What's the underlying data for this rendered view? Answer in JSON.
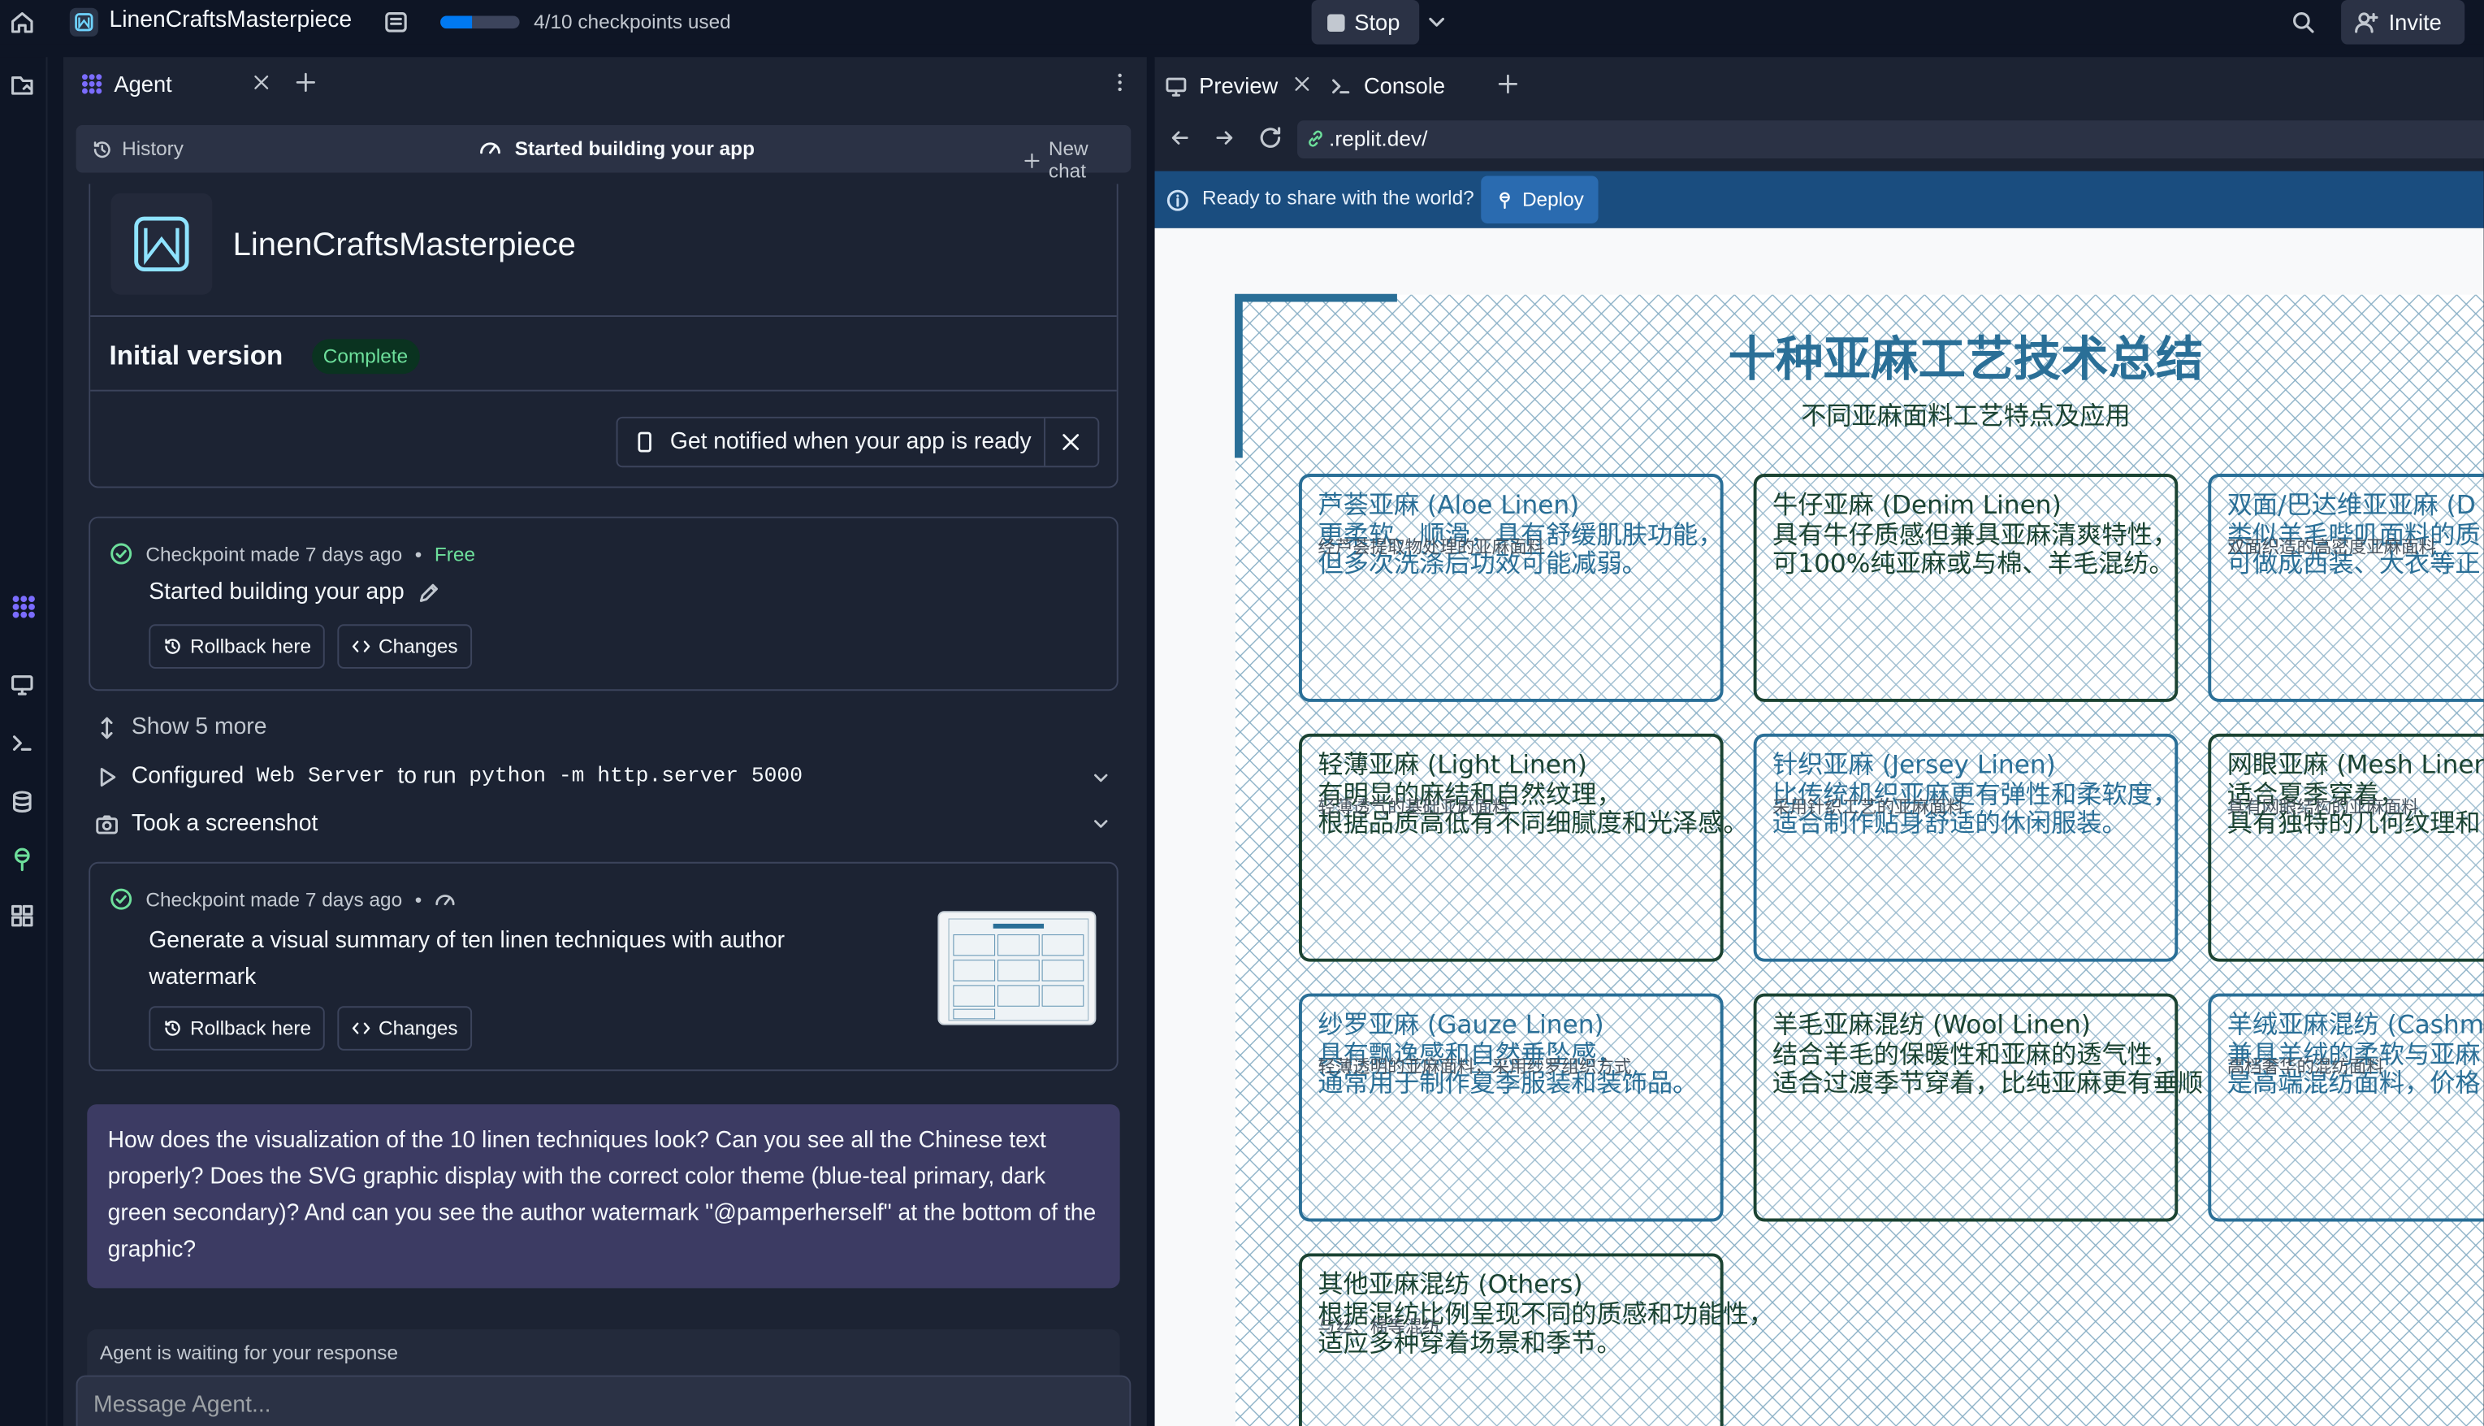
{
  "topbar": {
    "app_name": "LinenCraftsMasterpiece",
    "checkpoints_text": "4/10 checkpoints used",
    "checkpoints_progress": 0.4,
    "stop_label": "Stop",
    "invite_label": "Invite"
  },
  "agent_panel": {
    "tab_label": "Agent",
    "history_label": "History",
    "status_label": "Started building your app",
    "new_chat_label": "New chat",
    "app_title": "LinenCraftsMasterpiece",
    "initial_version_label": "Initial version",
    "complete_badge": "Complete",
    "notify_label": "Get notified when your app is ready",
    "checkpoint1": {
      "meta": "Checkpoint made 7 days ago",
      "separator": "•",
      "price": "Free",
      "title": "Started building your app",
      "rollback_label": "Rollback here",
      "changes_label": "Changes"
    },
    "show_more_label": "Show 5 more",
    "configured": {
      "prefix": "Configured",
      "workflow": "Web Server",
      "middle": "to run",
      "command": "python -m http.server 5000"
    },
    "screenshot_label": "Took a screenshot",
    "checkpoint2": {
      "meta": "Checkpoint made 7 days ago",
      "separator": "•",
      "title": "Generate a visual summary of ten linen techniques with author watermark",
      "rollback_label": "Rollback here",
      "changes_label": "Changes"
    },
    "user_message": "How does the visualization of the 10 linen techniques look? Can you see all the Chinese text properly? Does the SVG graphic display with the correct color theme (blue-teal primary, dark green secondary)? And can you see the author watermark \"@pamperherself\" at the bottom of the graphic?",
    "waiting_label": "Agent is waiting for your response",
    "message_placeholder": "Message Agent..."
  },
  "right_panel": {
    "preview_tab": "Preview",
    "console_tab": "Console",
    "url": ".replit.dev/",
    "deploy_prompt": "Ready to share with the world?",
    "deploy_label": "Deploy"
  },
  "preview": {
    "title": "十种亚麻工艺技术总结",
    "subtitle": "不同亚麻面料工艺特点及应用",
    "colors": {
      "primary": "#2a6f97",
      "secondary": "#1b4332"
    },
    "cards": [
      {
        "title": "芦荟亚麻 (Aloe Linen)",
        "line1": "更柔软、顺滑，具有舒缓肌肤功能，",
        "line2": "但多次洗涤后功效可能减弱。",
        "overlay": "经芦荟提取物处理的亚麻面料",
        "theme": "blue"
      },
      {
        "title": "牛仔亚麻 (Denim Linen)",
        "line1": "具有牛仔质感但兼具亚麻清爽特性，",
        "line2": "可100%纯亚麻或与棉、羊毛混纺。",
        "overlay": "",
        "theme": "green"
      },
      {
        "title": "双面/巴达维亚亚麻 (D",
        "line1": "类似羊毛哔叽面料的质",
        "line2": "可做成西装、大衣等正",
        "overlay": "双面织造的高密度亚麻面料",
        "theme": "blue"
      },
      {
        "title": "轻薄亚麻 (Light Linen)",
        "line1": "有明显的麻结和自然纹理，",
        "line2": "根据品质高低有不同细腻度和光泽感。",
        "overlay": "轻薄透气的基础亚麻面料",
        "theme": "green"
      },
      {
        "title": "针织亚麻 (Jersey Linen)",
        "line1": "比传统机织亚麻更有弹性和柔软度，",
        "line2": "适合制作贴身舒适的休闲服装。",
        "overlay": "采用针织工艺的亚麻面料",
        "theme": "blue"
      },
      {
        "title": "网眼亚麻 (Mesh Linen",
        "line1": "适合夏季穿着，",
        "line2": "具有独特的几何纹理和",
        "overlay": "具有网眼结构的亚麻面料",
        "theme": "green"
      },
      {
        "title": "纱罗亚麻 (Gauze Linen)",
        "line1": "具有飘逸感和自然垂坠感，",
        "line2": "通常用于制作夏季服装和装饰品。",
        "overlay": "轻薄透明的亚麻面料，采用纱罗组织方式",
        "theme": "blue"
      },
      {
        "title": "羊毛亚麻混纺 (Wool Linen)",
        "line1": "结合羊毛的保暖性和亚麻的透气性，",
        "line2": "适合过渡季节穿着，比纯亚麻更有垂顺",
        "overlay": "",
        "theme": "green"
      },
      {
        "title": "羊绒亚麻混纺 (Cashm",
        "line1": "兼具羊绒的柔软与亚麻",
        "line2": "是高端混纺面料，价格",
        "overlay": "高档奢华的混纺面料",
        "theme": "blue"
      },
      {
        "title": "其他亚麻混纺 (Others)",
        "line1": "根据混纺比例呈现不同的质感和功能性，",
        "line2": "适应多种穿着场景和季节。",
        "overlay": "与丝、棉等混纺",
        "theme": "green"
      }
    ]
  }
}
